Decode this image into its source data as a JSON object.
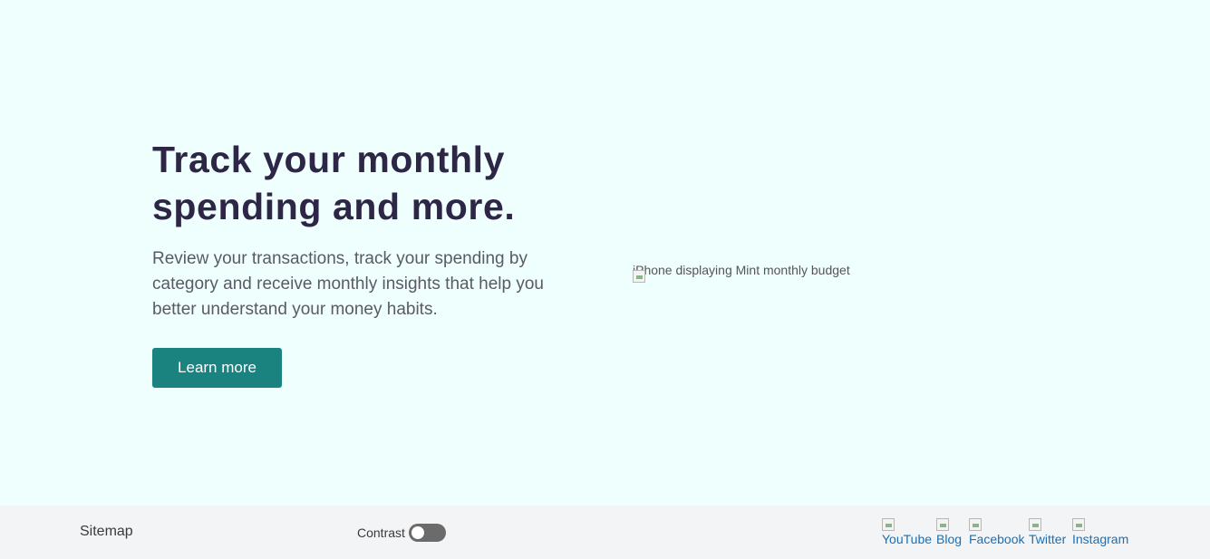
{
  "hero": {
    "title": "Track your monthly spending and more.",
    "description": "Review your transactions, track your spending by category and receive monthly insights that help you better understand your money habits.",
    "cta_label": "Learn more",
    "image_alt": "iPhone displaying Mint monthly budget"
  },
  "footer": {
    "sitemap_label": "Sitemap",
    "contrast_label": "Contrast",
    "contrast_on": false,
    "social": [
      {
        "label": "YouTube",
        "icon": "youtube-icon"
      },
      {
        "label": "Blog",
        "icon": "blog-icon"
      },
      {
        "label": "Facebook",
        "icon": "facebook-icon"
      },
      {
        "label": "Twitter",
        "icon": "twitter-icon"
      },
      {
        "label": "Instagram",
        "icon": "instagram-icon"
      }
    ]
  },
  "colors": {
    "background": "#effffe",
    "title": "#2e2647",
    "accent": "#1a8380",
    "link": "#1a6fb5",
    "footer_bg": "#f3f4f6"
  }
}
